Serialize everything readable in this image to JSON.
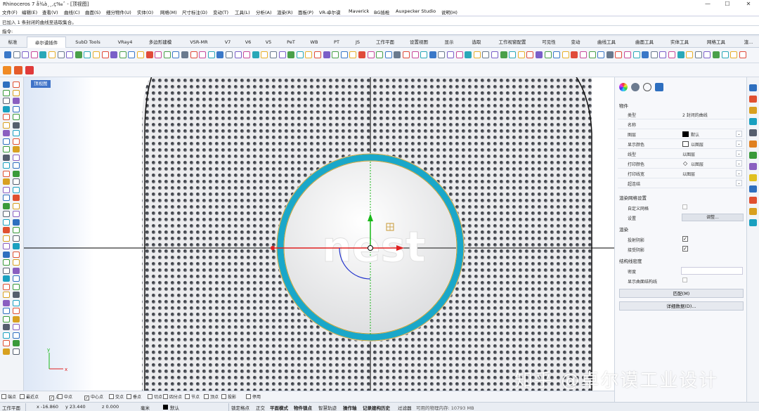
{
  "window": {
    "title": "Rhinoceros 7 å¾à¸¸,ç‰ˆ - [顶视图]",
    "controls": [
      "—",
      "☐",
      "✕"
    ]
  },
  "menu": [
    "文件(F)",
    "编辑(E)",
    "查看(V)",
    "曲线(C)",
    "曲面(S)",
    "细分物件(U)",
    "实体(O)",
    "网格(M)",
    "尺寸标注(D)",
    "变动(T)",
    "工具(L)",
    "分析(A)",
    "渲染(R)",
    "面板(P)",
    "VR-卓尔谟",
    "Maverick",
    "BG插枪",
    "Auxpecker Studio",
    "说明(H)"
  ],
  "command": {
    "history": "已加入 1 条封闭的曲线至选取集合。",
    "prompt": "指令:"
  },
  "tabs": [
    "标准",
    "卓尔谟插件",
    "SubD Tools",
    "VRay4",
    "多边形建模",
    "VSR-MR",
    "V7",
    "V6",
    "V5",
    "PeT",
    "WB",
    "PT",
    "JS",
    "工作平面",
    "设置视图",
    "显示",
    "选取",
    "工作视窗配置",
    "可见性",
    "变动",
    "曲线工具",
    "曲面工具",
    "实体工具",
    "网格工具",
    "渲..."
  ],
  "active_tab": "卓尔谟插件",
  "viewport": {
    "label": "顶视图",
    "logo_text": "nest"
  },
  "properties": {
    "section_object": "物件",
    "rows": [
      {
        "key": "类型",
        "value": "2 封闭的曲线"
      },
      {
        "key": "名称",
        "value": ""
      },
      {
        "key": "图层",
        "value": "默认"
      },
      {
        "key": "显示颜色",
        "value": "以图层"
      },
      {
        "key": "线型",
        "value": "以图层"
      },
      {
        "key": "打印颜色",
        "value": "以图层"
      },
      {
        "key": "打印线宽",
        "value": "以图层"
      },
      {
        "key": "超连结",
        "value": ""
      }
    ],
    "section_render_mesh": "渲染网格设置",
    "custom_mesh": "自定义网格",
    "settings": "设置",
    "adjust_button": "调整...",
    "section_render": "渲染",
    "cast_shadows": "投射阴影",
    "receive_shadows": "接受阴影",
    "section_isocurve": "结构线密度",
    "density": "密度",
    "show_isocurves": "显示曲面结构线",
    "match_button": "匹配(M)",
    "details_button": "详细数据(D)..."
  },
  "osnaps": [
    {
      "label": "端点",
      "checked": false
    },
    {
      "label": "最近点",
      "checked": false
    },
    {
      "label": "点",
      "checked": true
    },
    {
      "label": "中点",
      "checked": false
    },
    {
      "label": "中心点",
      "checked": true
    },
    {
      "label": "交点",
      "checked": false
    },
    {
      "label": "垂点",
      "checked": false
    },
    {
      "label": "切点",
      "checked": false
    },
    {
      "label": "四分点",
      "checked": false
    },
    {
      "label": "节点",
      "checked": false
    },
    {
      "label": "顶点",
      "checked": false
    },
    {
      "label": "投影",
      "checked": false
    },
    {
      "label": "停用",
      "checked": false
    }
  ],
  "status": {
    "cplane": "工作平面",
    "x": "x -16.860",
    "y": "y 23.440",
    "z": "z 0.000",
    "unit": "毫米",
    "layer": "默认",
    "grid_snap": "锁定格点",
    "ortho": "正交",
    "planar": "平面模式",
    "osnap": "物件锁点",
    "smarttrack": "智慧轨迹",
    "gumball": "操作轴",
    "history": "记录建构历史",
    "filter": "过滤器",
    "memory": "可用的物理内存: 10793 MB"
  },
  "watermark": "知乎 @卓尔谟工业设计",
  "colors": {
    "accent": "#3f73c8",
    "ring": "#1aa7c9",
    "gumball_x": "#e02020",
    "gumball_y": "#18b818"
  }
}
